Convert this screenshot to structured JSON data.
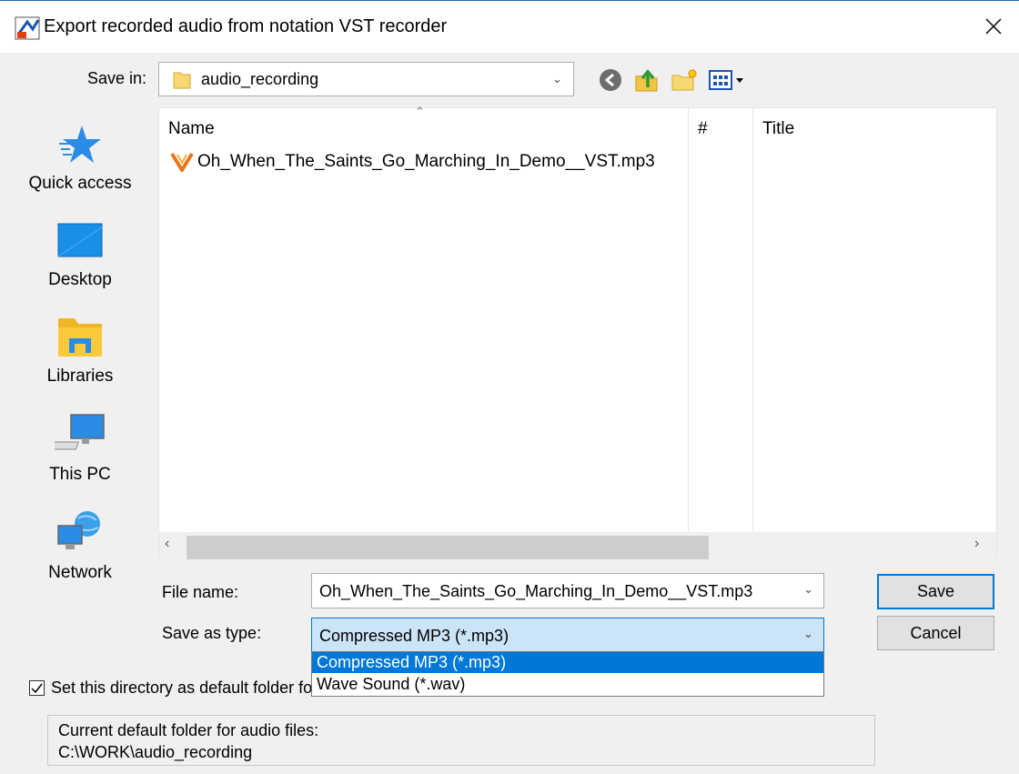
{
  "window": {
    "title": "Export recorded audio from notation VST recorder"
  },
  "save_in": {
    "label": "Save in:",
    "value": "audio_recording"
  },
  "places": [
    {
      "label": "Quick access",
      "icon": "star-icon"
    },
    {
      "label": "Desktop",
      "icon": "desktop-icon"
    },
    {
      "label": "Libraries",
      "icon": "libraries-icon"
    },
    {
      "label": "This PC",
      "icon": "computer-icon"
    },
    {
      "label": "Network",
      "icon": "network-icon"
    }
  ],
  "file_list": {
    "columns": [
      "Name",
      "#",
      "Title"
    ],
    "files": [
      {
        "name": "Oh_When_The_Saints_Go_Marching_In_Demo__VST.mp3",
        "icon": "mp3-file-icon"
      }
    ]
  },
  "form": {
    "file_name_label": "File name:",
    "file_name_value": "Oh_When_The_Saints_Go_Marching_In_Demo__VST.mp3",
    "type_label": "Save as type:",
    "type_value": "Compressed MP3 (*.mp3)",
    "type_options": [
      "Compressed MP3 (*.mp3)",
      "Wave Sound (*.wav)"
    ]
  },
  "buttons": {
    "save": "Save",
    "cancel": "Cancel"
  },
  "checkbox": {
    "label": "Set this directory as default folder for audio files",
    "checked": true
  },
  "info": {
    "line1": "Current default folder for audio files:",
    "line2": "C:\\WORK\\audio_recording"
  },
  "colors": {
    "accent": "#0078d7",
    "selection_bg": "#cce4f7"
  }
}
